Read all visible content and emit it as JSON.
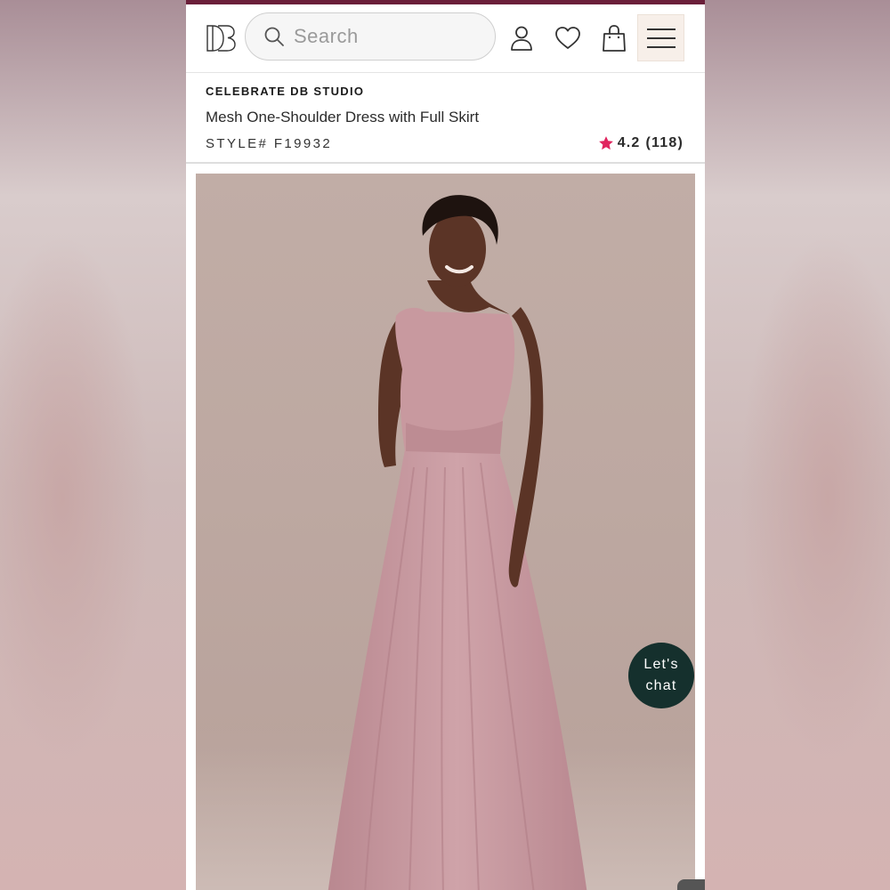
{
  "header": {
    "logo_text": "DB",
    "search_placeholder": "Search",
    "icons": [
      "search-icon",
      "account-icon",
      "heart-icon",
      "shopping-bag-icon",
      "hamburger-menu-icon"
    ]
  },
  "product": {
    "brand": "CELEBRATE DB STUDIO",
    "name": "Mesh One-Shoulder Dress with Full Skirt",
    "style": "STYLE# F19932",
    "rating_value": "4.2",
    "rating_count": "(118)",
    "rating_star_color": "#e0245e",
    "image_alt": "Model wearing a dusty rose mesh one-shoulder dress with full skirt"
  },
  "chat": {
    "line1": "Let's",
    "line2": "chat"
  },
  "colors": {
    "top_stripe": "#6b1f3a",
    "dress": "#c99ea4",
    "chat_bubble": "#15302d"
  }
}
